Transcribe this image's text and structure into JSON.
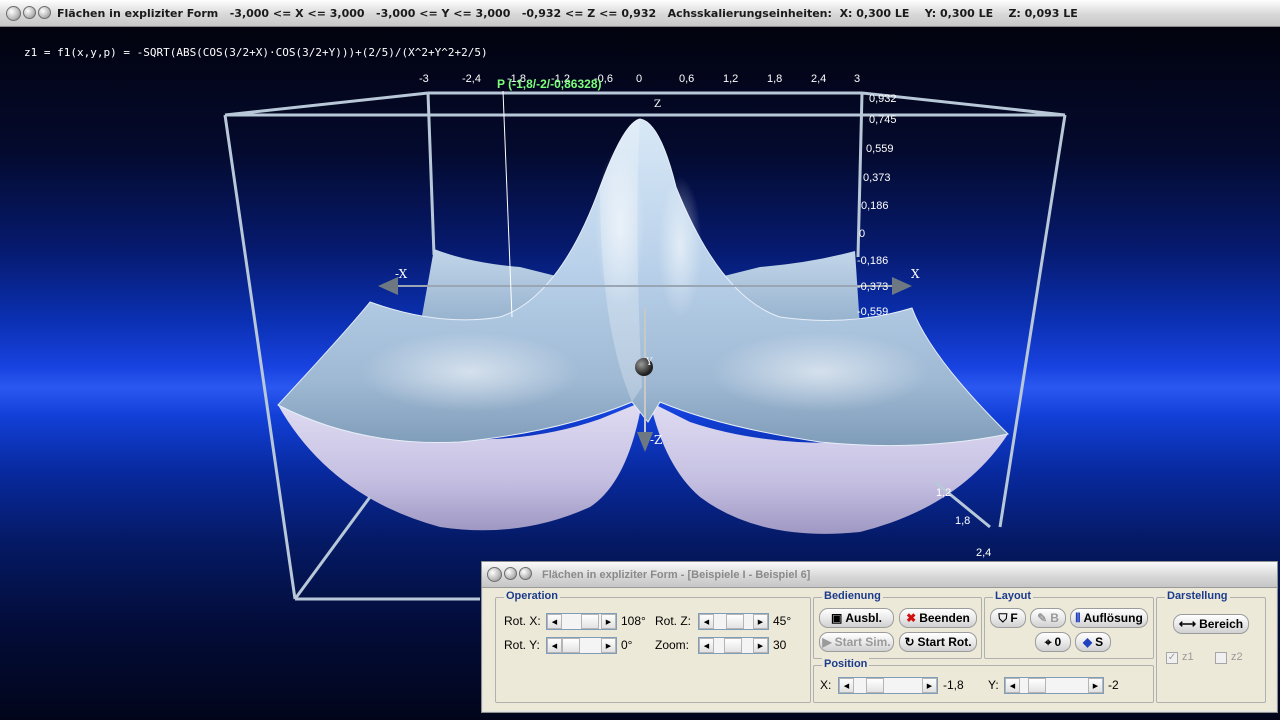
{
  "main_window": {
    "title": "Flächen in expliziter Form   -3,000 <= X <= 3,000   -3,000 <= Y <= 3,000   -0,932 <= Z <= 0,932   Achsskalierungseinheiten:  X: 0,300 LE    Y: 0,300 LE    Z: 0,093 LE"
  },
  "viewport": {
    "formula": "z1 = f1(x,y,p) = -SQRT(ABS(COS(3/2+X)·COS(3/2+Y)))+(2/5)/(X^2+Y^2+2/5)",
    "point_label": "P (-1,8/-2/-0,86328)",
    "x_ticks": [
      "-3",
      "-2,4",
      "-1,8",
      "-1,2",
      "-0,6",
      "0",
      "0,6",
      "1,2",
      "1,8",
      "2,4",
      "3"
    ],
    "z_ticks": [
      "0,932",
      "0,745",
      "0,559",
      "0,373",
      "0,186",
      "0",
      "-0,186",
      "-0,373",
      "-0,559"
    ],
    "y_ticks": [
      "1,2",
      "1,8",
      "2,4"
    ],
    "axis_labels": {
      "neg_x": "-X",
      "pos_x": "X",
      "z": "Z",
      "y": "Y",
      "neg_z": "-Z"
    }
  },
  "dialog": {
    "title": "Flächen in expliziter Form - [Beispiele I - Beispiel 6]",
    "operation": {
      "title": "Operation",
      "rot_x_label": "Rot. X:",
      "rot_x_value": "108°",
      "rot_z_label": "Rot. Z:",
      "rot_z_value": "45°",
      "rot_y_label": "Rot. Y:",
      "rot_y_value": "0°",
      "zoom_label": "Zoom:",
      "zoom_value": "30"
    },
    "bedienung": {
      "title": "Bedienung",
      "ausbl": "Ausbl.",
      "beenden": "Beenden",
      "start_sim": "Start Sim.",
      "start_rot": "Start Rot."
    },
    "layout": {
      "title": "Layout",
      "f": "F",
      "b": "B",
      "aufloesung": "Auflösung",
      "o": "0",
      "s": "S"
    },
    "position": {
      "title": "Position",
      "x_label": "X:",
      "x_value": "-1,8",
      "y_label": "Y:",
      "y_value": "-2"
    },
    "darstellung": {
      "title": "Darstellung",
      "bereich": "Bereich",
      "z1": "z1",
      "z2": "z2",
      "z1_checked": true,
      "z2_checked": false
    }
  },
  "colors": {
    "surface_top": "#c9dcef",
    "surface_shadow": "#7f9cb8",
    "surface_bottom": "#c8c4e6",
    "box_frame": "#b8c8d8",
    "point_label": "#7dff7d",
    "group_title": "#1c3b8c"
  }
}
